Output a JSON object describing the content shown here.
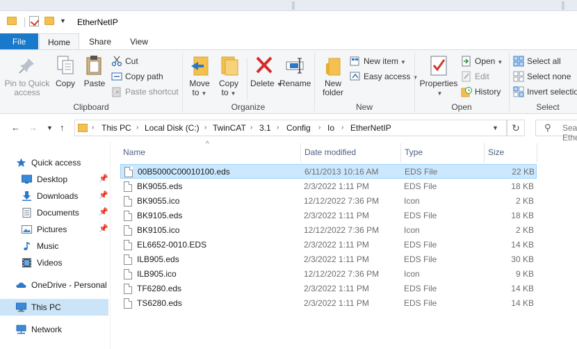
{
  "window": {
    "title": "EtherNetIP"
  },
  "ribbon_tabs": [
    "File",
    "Home",
    "Share",
    "View"
  ],
  "clipboard": {
    "pin_label_1": "Pin to Quick",
    "pin_label_2": "access",
    "copy": "Copy",
    "paste": "Paste",
    "cut": "Cut",
    "copy_path": "Copy path",
    "paste_shortcut": "Paste shortcut",
    "group": "Clipboard"
  },
  "organize": {
    "move_1": "Move",
    "move_2": "to",
    "copy_1": "Copy",
    "copy_2": "to",
    "delete": "Delete",
    "rename": "Rename",
    "group": "Organize"
  },
  "new": {
    "new_folder_1": "New",
    "new_folder_2": "folder",
    "new_item": "New item",
    "easy_access": "Easy access",
    "group": "New"
  },
  "open": {
    "properties": "Properties",
    "open": "Open",
    "edit": "Edit",
    "history": "History",
    "group": "Open"
  },
  "select": {
    "select_all": "Select all",
    "select_none": "Select none",
    "invert": "Invert selection",
    "group": "Select"
  },
  "address": {
    "crumbs": [
      "This PC",
      "Local Disk (C:)",
      "TwinCAT",
      "3.1",
      "Config",
      "Io",
      "EtherNetIP"
    ],
    "search_placeholder": "Search EtherNetIP"
  },
  "nav_pane": {
    "quick_access": "Quick access",
    "desktop": "Desktop",
    "downloads": "Downloads",
    "documents": "Documents",
    "pictures": "Pictures",
    "music": "Music",
    "videos": "Videos",
    "onedrive": "OneDrive - Personal",
    "this_pc": "This PC",
    "network": "Network"
  },
  "columns": {
    "name": "Name",
    "date": "Date modified",
    "type": "Type",
    "size": "Size"
  },
  "files": [
    {
      "name": "00B5000C00010100.eds",
      "date": "6/11/2013 10:16 AM",
      "type": "EDS File",
      "size": "22 KB"
    },
    {
      "name": "BK9055.eds",
      "date": "2/3/2022 1:11 PM",
      "type": "EDS File",
      "size": "18 KB"
    },
    {
      "name": "BK9055.ico",
      "date": "12/12/2022 7:36 PM",
      "type": "Icon",
      "size": "2 KB"
    },
    {
      "name": "BK9105.eds",
      "date": "2/3/2022 1:11 PM",
      "type": "EDS File",
      "size": "18 KB"
    },
    {
      "name": "BK9105.ico",
      "date": "12/12/2022 7:36 PM",
      "type": "Icon",
      "size": "2 KB"
    },
    {
      "name": "EL6652-0010.EDS",
      "date": "2/3/2022 1:11 PM",
      "type": "EDS File",
      "size": "14 KB"
    },
    {
      "name": "ILB905.eds",
      "date": "2/3/2022 1:11 PM",
      "type": "EDS File",
      "size": "30 KB"
    },
    {
      "name": "ILB905.ico",
      "date": "12/12/2022 7:36 PM",
      "type": "Icon",
      "size": "9 KB"
    },
    {
      "name": "TF6280.eds",
      "date": "2/3/2022 1:11 PM",
      "type": "EDS File",
      "size": "14 KB"
    },
    {
      "name": "TS6280.eds",
      "date": "2/3/2022 1:11 PM",
      "type": "EDS File",
      "size": "14 KB"
    }
  ],
  "colors": {
    "accent": "#1979ca",
    "selection": "#cce8ff",
    "nav_selection": "#cce4f7",
    "folder": "#f4c04e"
  }
}
